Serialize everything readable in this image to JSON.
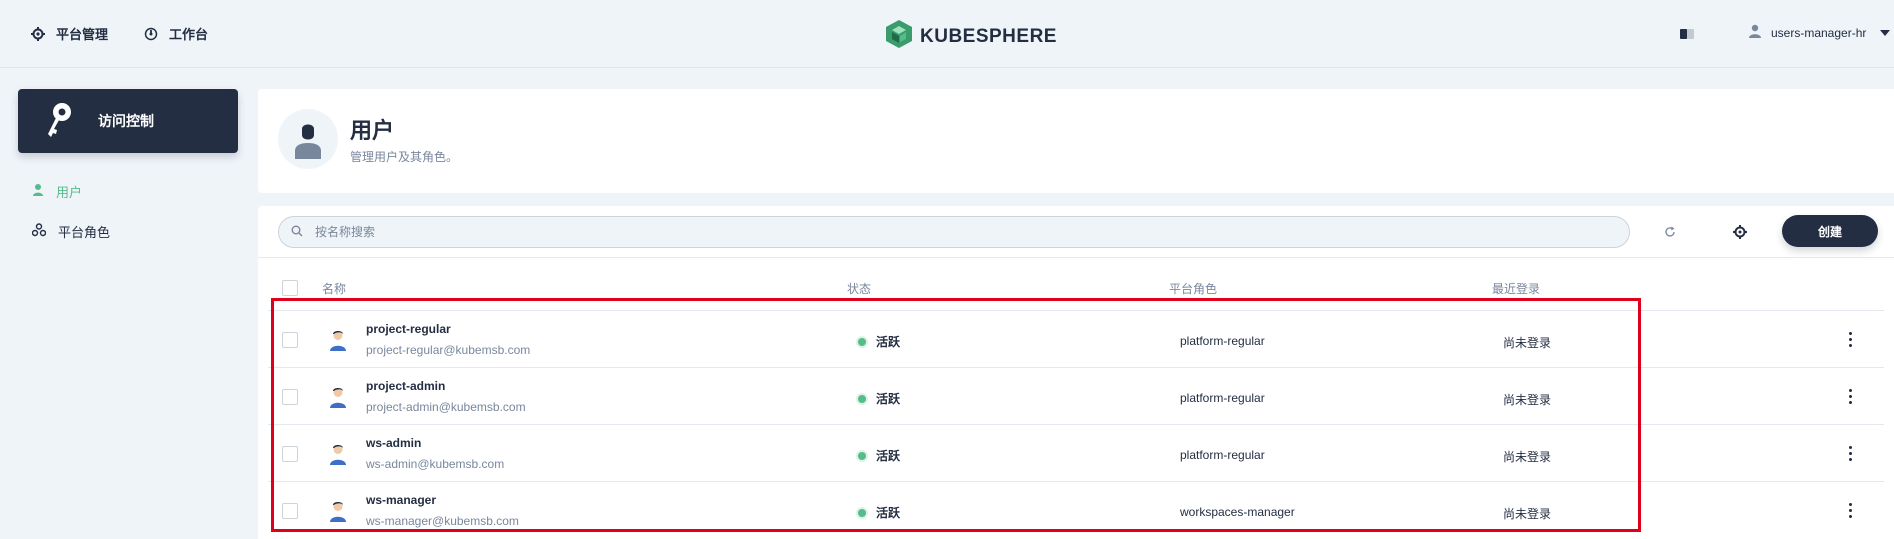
{
  "topbar": {
    "nav": [
      {
        "label": "平台管理",
        "icon": "gear-icon"
      },
      {
        "label": "工作台",
        "icon": "dashboard-icon"
      }
    ],
    "logo_text": "KUBESPHERE",
    "user_name": "users-manager-hr"
  },
  "sidebar": {
    "section_title": "访问控制",
    "items": [
      {
        "label": "用户",
        "icon": "user-icon",
        "active": true
      },
      {
        "label": "平台角色",
        "icon": "roles-icon",
        "active": false
      }
    ]
  },
  "banner": {
    "title": "用户",
    "subtitle": "管理用户及其角色。"
  },
  "toolbar": {
    "search_placeholder": "按名称搜索",
    "create_label": "创建"
  },
  "table": {
    "columns": [
      "名称",
      "状态",
      "平台角色",
      "最近登录"
    ],
    "rows": [
      {
        "name": "project-regular",
        "email": "project-regular@kubemsb.com",
        "status": "活跃",
        "role": "platform-regular",
        "last_login": "尚未登录"
      },
      {
        "name": "project-admin",
        "email": "project-admin@kubemsb.com",
        "status": "活跃",
        "role": "platform-regular",
        "last_login": "尚未登录"
      },
      {
        "name": "ws-admin",
        "email": "ws-admin@kubemsb.com",
        "status": "活跃",
        "role": "platform-regular",
        "last_login": "尚未登录"
      },
      {
        "name": "ws-manager",
        "email": "ws-manager@kubemsb.com",
        "status": "活跃",
        "role": "workspaces-manager",
        "last_login": "尚未登录"
      }
    ]
  },
  "colors": {
    "accent_green": "#55bc8a",
    "dark": "#242e42",
    "highlight_red": "#e0001b"
  }
}
